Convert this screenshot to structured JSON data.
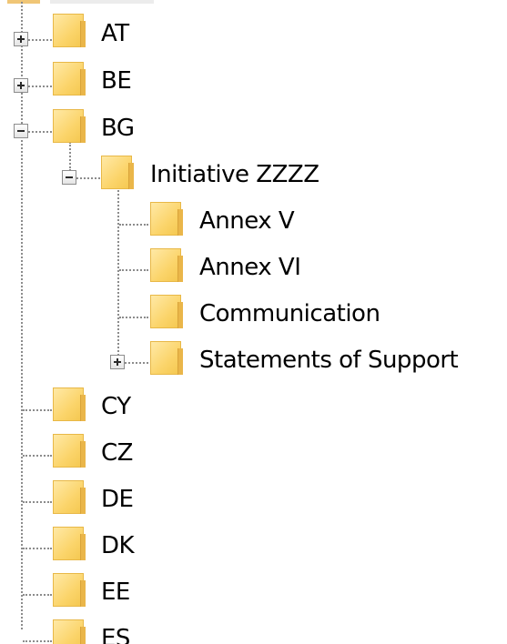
{
  "tree": {
    "nodes": {
      "at": {
        "label": "AT",
        "state": "collapsed"
      },
      "be": {
        "label": "BE",
        "state": "collapsed"
      },
      "bg": {
        "label": "BG",
        "state": "expanded"
      },
      "initiative": {
        "label": "Initiative ZZZZ",
        "state": "expanded"
      },
      "annex_v": {
        "label": "Annex V"
      },
      "annex_vi": {
        "label": "Annex VI"
      },
      "communication": {
        "label": "Communication"
      },
      "statements": {
        "label": "Statements of Support",
        "state": "collapsed"
      },
      "cy": {
        "label": "CY"
      },
      "cz": {
        "label": "CZ"
      },
      "de": {
        "label": "DE"
      },
      "dk": {
        "label": "DK"
      },
      "ee": {
        "label": "EE"
      },
      "es": {
        "label": "ES"
      }
    },
    "icons": {
      "folder": "folder-icon",
      "expand": "plus-box-icon",
      "collapse": "minus-box-icon"
    },
    "colors": {
      "folder": "#fbd46a",
      "connector": "#8c8c8c",
      "background": "#ffffff"
    }
  }
}
